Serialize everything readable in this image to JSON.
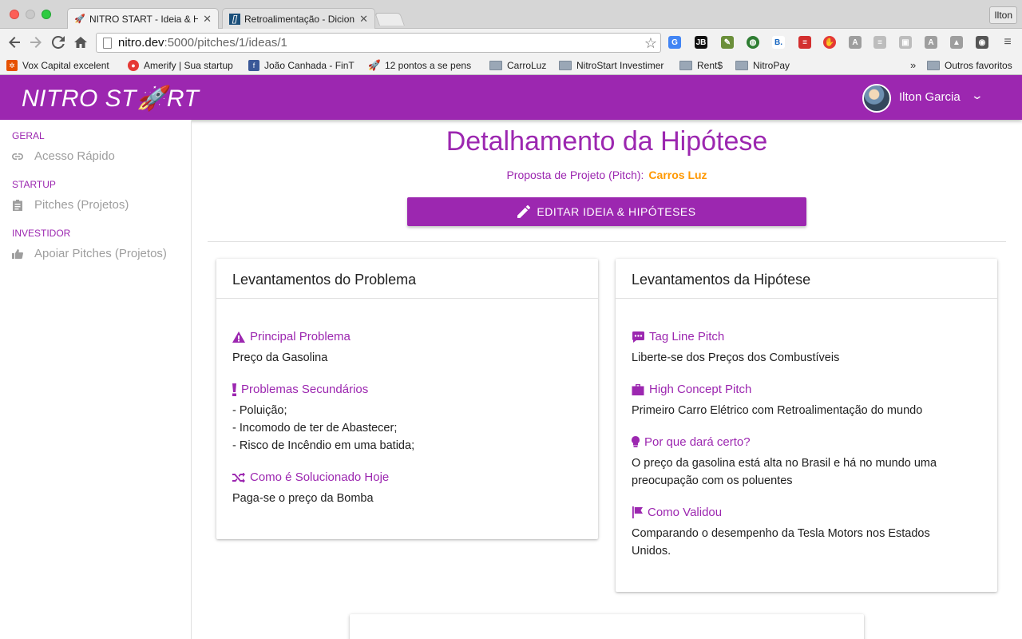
{
  "browser": {
    "tabs": [
      {
        "title": "NITRO START - Ideia & Hip",
        "active": true
      },
      {
        "title": "Retroalimentação - Dicioná",
        "active": false
      }
    ],
    "profile": "Ilton",
    "url_host": "nitro.dev",
    "url_path": ":5000/pitches/1/ideas/1",
    "bookmarks": [
      {
        "label": "Vox Capital excelent",
        "type": "site"
      },
      {
        "label": "Amerify | Sua startup",
        "type": "site"
      },
      {
        "label": "João Canhada - FinT",
        "type": "site"
      },
      {
        "label": "12 pontos a se pens",
        "type": "site"
      },
      {
        "label": "CarroLuz",
        "type": "folder"
      },
      {
        "label": "NitroStart Investimer",
        "type": "folder"
      },
      {
        "label": "Rent$",
        "type": "folder"
      },
      {
        "label": "NitroPay",
        "type": "folder"
      }
    ],
    "bookmarks_more": "»",
    "other_bookmarks": "Outros favoritos"
  },
  "header": {
    "logo_left": "NITRO ST",
    "logo_rocket": "🚀",
    "logo_right": "RT",
    "user_name": "Ilton Garcia",
    "brand_color": "#9c27b0"
  },
  "sidebar": {
    "sections": [
      {
        "title": "GERAL",
        "items": [
          {
            "label": "Acesso Rápido",
            "icon": "link-icon"
          }
        ]
      },
      {
        "title": "STARTUP",
        "items": [
          {
            "label": "Pitches (Projetos)",
            "icon": "clipboard-icon"
          }
        ]
      },
      {
        "title": "INVESTIDOR",
        "items": [
          {
            "label": "Apoiar Pitches (Projetos)",
            "icon": "thumbs-up-icon"
          }
        ]
      }
    ]
  },
  "main": {
    "title": "Detalhamento da Hipótese",
    "pitch_label": "Proposta de Projeto (Pitch):",
    "pitch_name": "Carros Luz",
    "edit_button": "EDITAR IDEIA & HIPÓTESES",
    "problem_card": {
      "title": "Levantamentos do Problema",
      "fields": [
        {
          "label": "Principal Problema",
          "icon": "warning-icon",
          "lines": [
            "Preço da Gasolina"
          ]
        },
        {
          "label": "Problemas Secundários",
          "icon": "exclamation-icon",
          "lines": [
            "- Poluição;",
            "- Incomodo de ter de Abastecer;",
            "- Risco de Incêndio em uma batida;"
          ]
        },
        {
          "label": "Como é Solucionado Hoje",
          "icon": "shuffle-icon",
          "lines": [
            "Paga-se o preço da Bomba"
          ]
        }
      ]
    },
    "hypothesis_card": {
      "title": "Levantamentos da Hipótese",
      "fields": [
        {
          "label": "Tag Line Pitch",
          "icon": "comment-icon",
          "lines": [
            "Liberte-se dos Preços dos Combustíveis"
          ]
        },
        {
          "label": "High Concept Pitch",
          "icon": "briefcase-icon",
          "lines": [
            "Primeiro Carro Elétrico com Retroalimentação do mundo"
          ]
        },
        {
          "label": "Por que dará certo?",
          "icon": "lightbulb-icon",
          "lines": [
            "O preço da gasolina está alta no Brasil e há no mundo uma",
            "preocupação com os poluentes"
          ]
        },
        {
          "label": "Como Validou",
          "icon": "flag-icon",
          "lines": [
            "Comparando o desempenho da Tesla Motors nos Estados",
            "Unidos."
          ]
        }
      ]
    }
  }
}
